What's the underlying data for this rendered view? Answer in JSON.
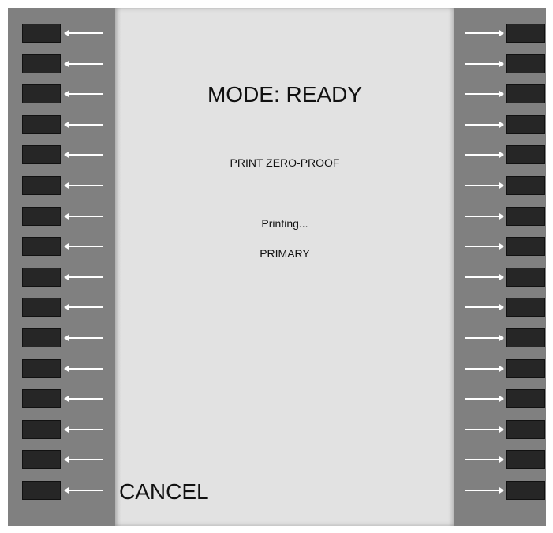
{
  "screen": {
    "mode_label": "MODE: READY",
    "operation": "PRINT ZERO-PROOF",
    "status": "Printing...",
    "target": "PRIMARY",
    "cancel_label": "CANCEL"
  },
  "colors": {
    "bezel": "#808080",
    "screen_bg": "#e2e2e2",
    "softkey": "#262626",
    "arrow": "#ffffff"
  },
  "softkeys": {
    "left_count": 16,
    "right_count": 16
  }
}
